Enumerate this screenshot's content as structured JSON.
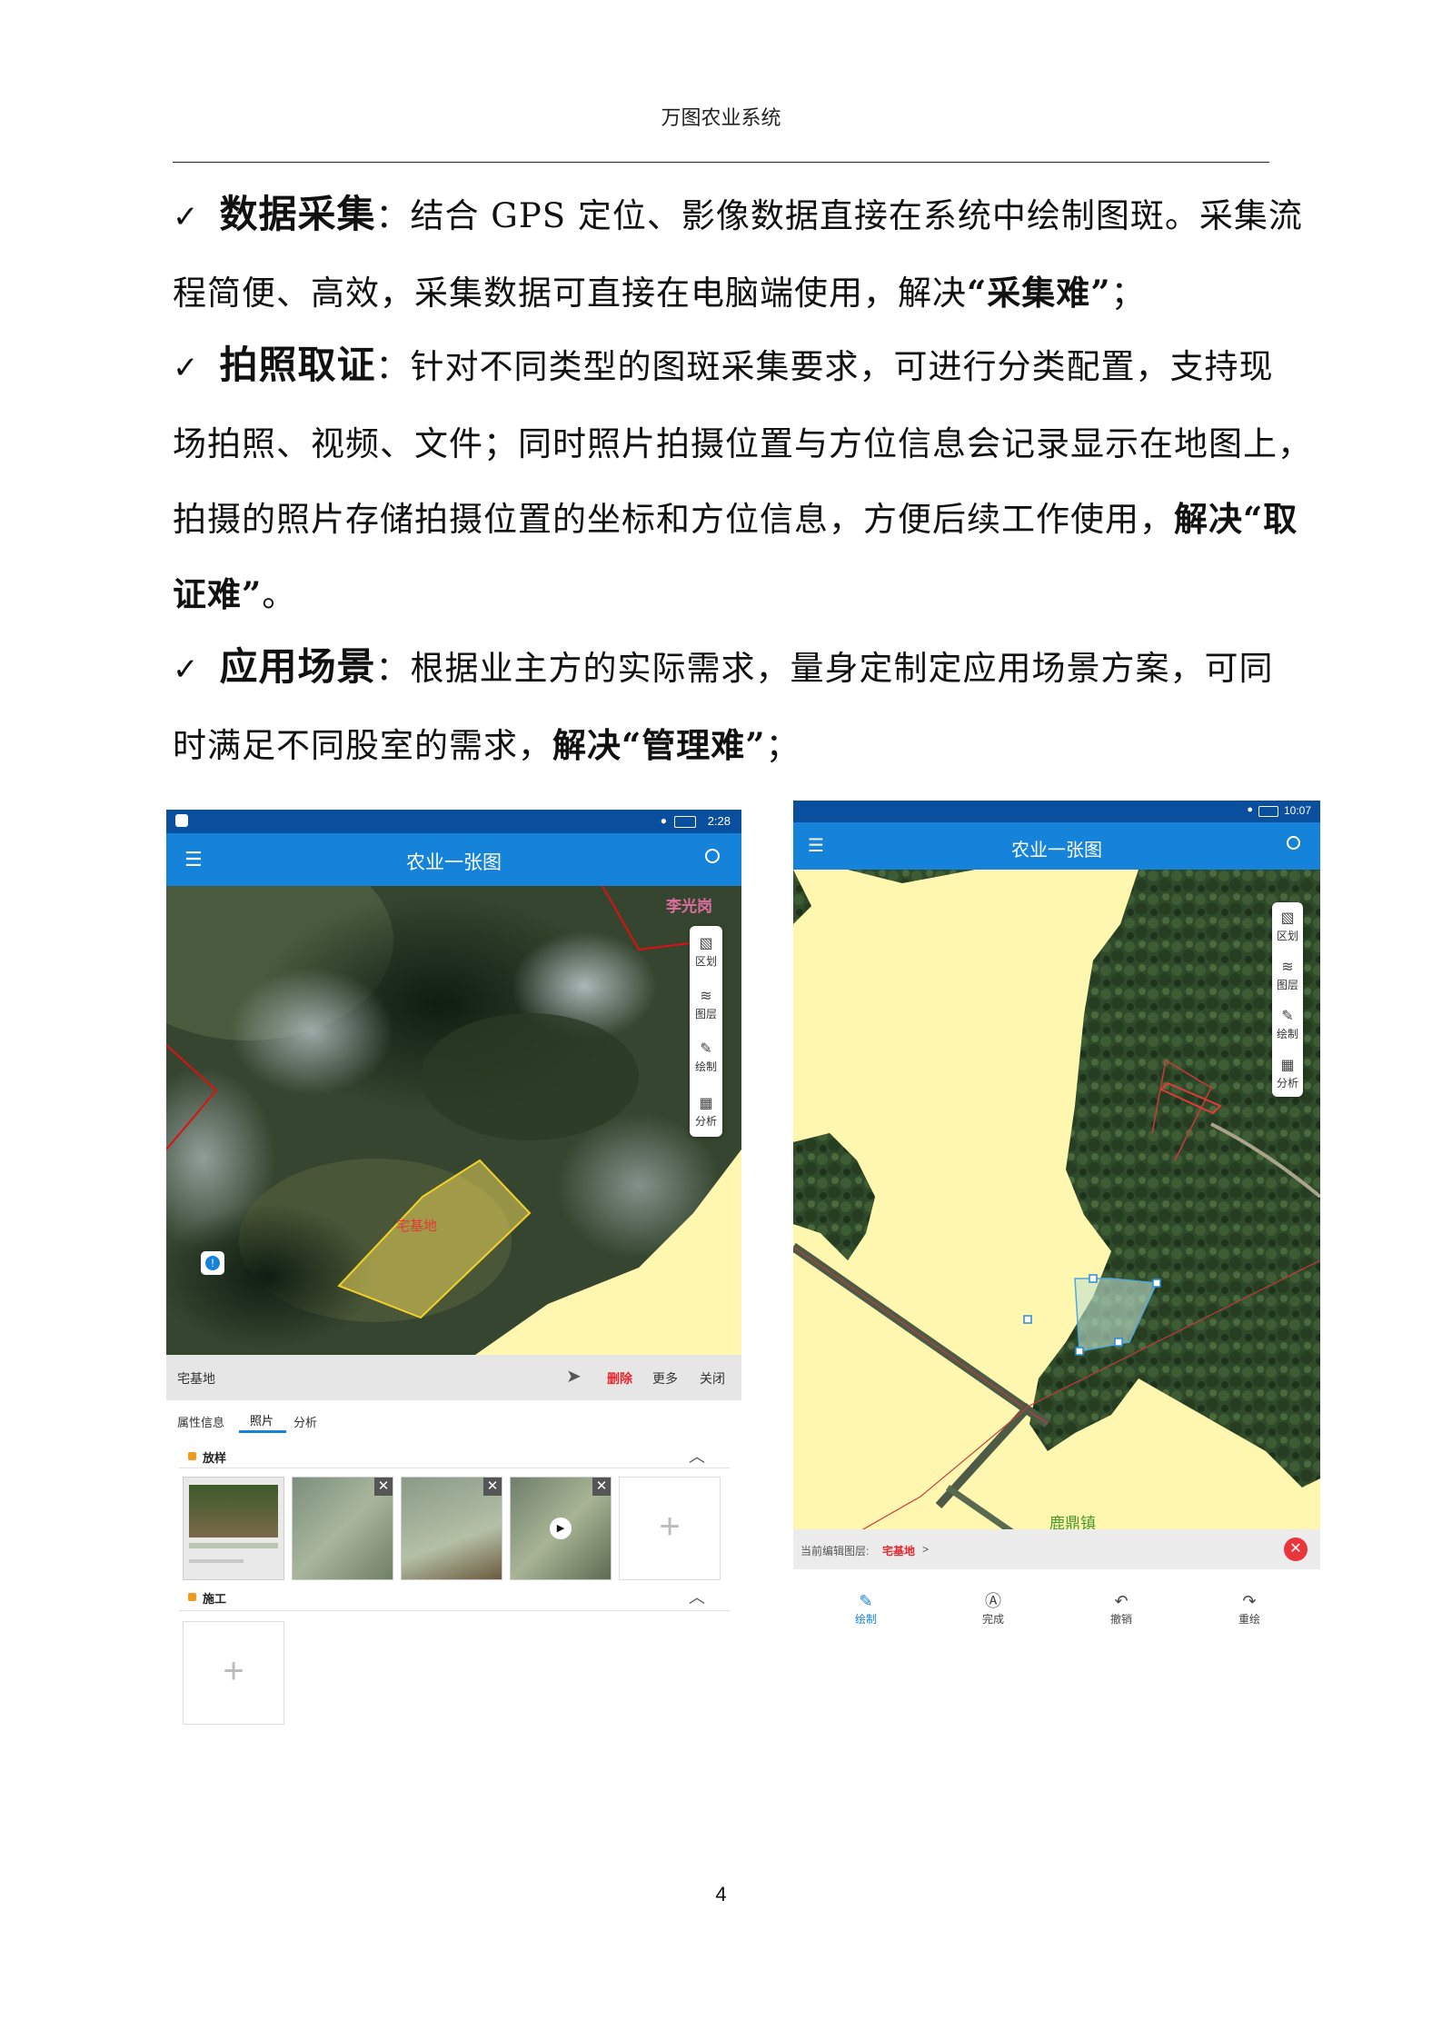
{
  "header": "万图农业系统",
  "page_number": "4",
  "paragraphs": [
    {
      "check": "✓",
      "lead": "数据采集",
      "colon": "：",
      "line1": "结合 GPS 定位、影像数据直接在系统中绘制图斑。采集流",
      "line2_pre": "程简便、高效，采集数据可直接在电脑端使用，解决",
      "line2_bold": "“采集难”",
      "line2_post": "；"
    },
    {
      "check": "✓",
      "lead": "拍照取证",
      "colon": "：",
      "line1": "针对不同类型的图斑采集要求，可进行分类配置，支持现",
      "line2": "场拍照、视频、文件；同时照片拍摄位置与方位信息会记录显示在地图上，",
      "line3_pre": "拍摄的照片存储拍摄位置的坐标和方位信息，方便后续工作使用，",
      "line3_bold": "解决“取",
      "line4_bold": "证难”",
      "line4_post": "。"
    },
    {
      "check": "✓",
      "lead": "应用场景",
      "colon": "：",
      "line1": "根据业主方的实际需求，量身定制定应用场景方案，可同",
      "line2_pre": "时满足不同股室的需求，",
      "line2_bold": "解决“管理难”",
      "line2_post": "；"
    }
  ],
  "phone_left": {
    "status_time": "2:28",
    "app_title": "农业一张图",
    "menu_icon": "menu-icon",
    "search_icon": "search-icon",
    "map_label_village": "李光岗",
    "map_label_plot": "宅基地",
    "tools": [
      {
        "icon": "region-icon",
        "label": "区划"
      },
      {
        "icon": "layers-icon",
        "label": "图层"
      },
      {
        "icon": "draw-icon",
        "label": "绘制"
      },
      {
        "icon": "analysis-icon",
        "label": "分析"
      }
    ],
    "sheet": {
      "title": "宅基地",
      "delete": "删除",
      "more": "更多",
      "close": "关闭",
      "tabs": [
        "属性信息",
        "照片",
        "分析"
      ],
      "active_tab": "照片",
      "section1": "放样",
      "section2": "施工"
    }
  },
  "phone_right": {
    "status_time": "10:07",
    "app_title": "农业一张图",
    "tools": [
      {
        "icon": "region-icon",
        "label": "区划"
      },
      {
        "icon": "layers-icon",
        "label": "图层"
      },
      {
        "icon": "draw-icon",
        "label": "绘制"
      },
      {
        "icon": "analysis-icon",
        "label": "分析"
      }
    ],
    "map_label_town": "鹿鼎镇",
    "edit_layer_prefix": "当前编辑图层:",
    "edit_layer_name": "宅基地",
    "edit_layer_suffix": ">",
    "bottom_nav": [
      {
        "icon": "pen-icon",
        "label": "绘制"
      },
      {
        "icon": "done-icon",
        "label": "完成"
      },
      {
        "icon": "undo-icon",
        "label": "撤销"
      },
      {
        "icon": "redo-icon",
        "label": "重绘"
      }
    ]
  },
  "colors": {
    "app_blue": "#1683da",
    "status_blue": "#0a4f9e",
    "delete_red": "#e8262d",
    "land_yellow": "#fff6b0",
    "town_green": "#4a9a2a"
  }
}
